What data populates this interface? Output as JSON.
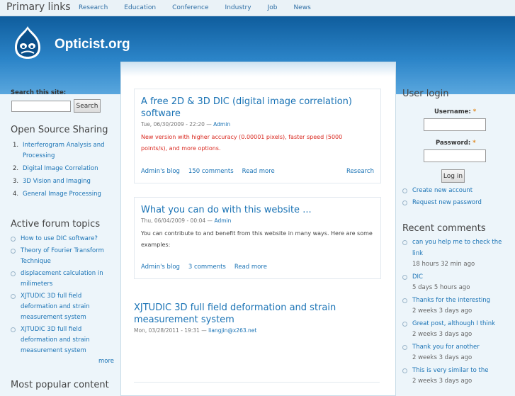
{
  "primary": {
    "title": "Primary links",
    "links": [
      "Research",
      "Education",
      "Conference",
      "Industry",
      "Job",
      "News"
    ]
  },
  "site": {
    "name": "Opticist.org"
  },
  "search": {
    "label": "Search this site:",
    "button": "Search"
  },
  "open_source": {
    "title": "Open Source Sharing",
    "items": [
      {
        "num": "1.",
        "label": "Interferogram Analysis and Processing"
      },
      {
        "num": "2.",
        "label": "Digital Image Correlation"
      },
      {
        "num": "3.",
        "label": "3D Vision and Imaging"
      },
      {
        "num": "4.",
        "label": "General Image Processing"
      }
    ]
  },
  "forum": {
    "title": "Active forum topics",
    "items": [
      "How to use DIC software?",
      "Theory of Fourier Transform Technique",
      "displacement calculation in milimeters",
      "XJTUDIC 3D full field deformation and strain measurement system",
      "XJTUDIC 3D full field deformation and strain measurement system"
    ],
    "more": "more"
  },
  "popular": {
    "title": "Most popular content"
  },
  "nodes": [
    {
      "title": "A free 2D & 3D DIC (digital image correlation) software",
      "date": "Tue, 06/30/2009 - 22:20 — ",
      "author": "Admin",
      "body": "New version with higher accuracy (0.00001 pixels), faster speed (5000 points/s), and more options.",
      "links": [
        "Admin's blog",
        "150 comments",
        "Read more"
      ],
      "term": "Research"
    },
    {
      "title": "What you can do with this website ...",
      "date": "Thu, 06/04/2009 - 00:04 — ",
      "author": "Admin",
      "body": "You can contribute to and benefit from this website in many ways. Here are some examples:",
      "links": [
        "Admin's blog",
        "3 comments",
        "Read more"
      ]
    },
    {
      "title": "XJTUDIC 3D full field deformation and strain measurement system",
      "date": "Mon, 03/28/2011 - 19:31 — ",
      "author": "liangjin@x263.net"
    }
  ],
  "login": {
    "title": "User login",
    "username_label": "Username:",
    "password_label": "Password:",
    "required_mark": "*",
    "button": "Log in",
    "links": [
      "Create new account",
      "Request new password"
    ]
  },
  "recent": {
    "title": "Recent comments",
    "items": [
      {
        "text": "can you help me to check the link",
        "time": "18 hours 32 min ago"
      },
      {
        "text": "DIC",
        "time": "5 days 5 hours ago"
      },
      {
        "text": "Thanks for the interesting",
        "time": "2 weeks 3 days ago"
      },
      {
        "text": "Great post, although I think",
        "time": "2 weeks 3 days ago"
      },
      {
        "text": "Thank you for another",
        "time": "2 weeks 3 days ago"
      },
      {
        "text": "This is very similar to the",
        "time": "2 weeks 3 days ago"
      }
    ]
  },
  "colors": {
    "accent": "#1a73b5",
    "header": "#2b84c8",
    "highlight": "#d9281f"
  }
}
